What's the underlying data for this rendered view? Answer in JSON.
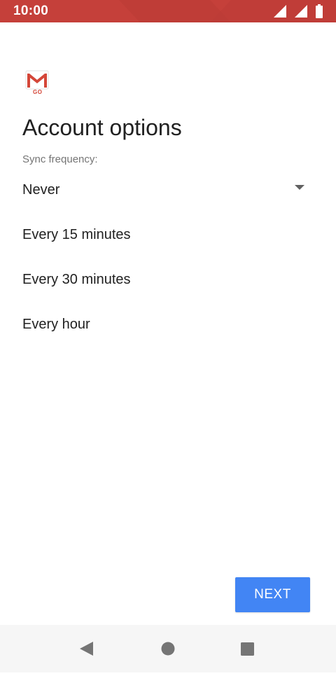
{
  "status_bar": {
    "time": "10:00",
    "color": "#c5403a",
    "icons": [
      "signal-icon",
      "wifi-signal-icon",
      "battery-icon"
    ]
  },
  "app": {
    "logo_icon": "gmail-go-logo-icon",
    "logo_text": "GO"
  },
  "page": {
    "title": "Account options"
  },
  "sync": {
    "label": "Sync frequency:",
    "selected": "Never",
    "options": [
      "Every 15 minutes",
      "Every 30 minutes",
      "Every hour"
    ]
  },
  "actions": {
    "next_label": "NEXT",
    "next_color": "#4285f4"
  },
  "nav_bar": {
    "icons": [
      "back-icon",
      "home-icon",
      "recents-icon"
    ]
  }
}
